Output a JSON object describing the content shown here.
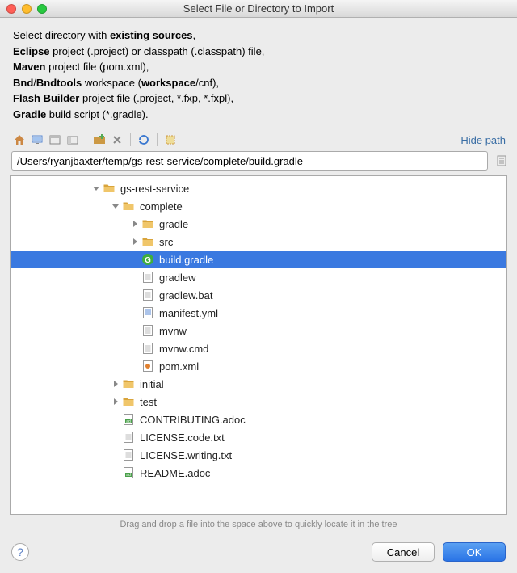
{
  "window": {
    "title": "Select File or Directory to Import"
  },
  "instructions": {
    "line1": {
      "prefix": "Select directory with ",
      "bold": "existing sources",
      "suffix": ","
    },
    "line2": {
      "bold": "Eclipse",
      "rest": " project (.project) or classpath (.classpath) file,"
    },
    "line3": {
      "bold": "Maven",
      "rest": " project file (pom.xml),"
    },
    "line4": {
      "b1": "Bnd",
      "sep": "/",
      "b2": "Bndtools",
      "mid": " workspace (",
      "b3": "workspace",
      "rest": "/cnf),"
    },
    "line5": {
      "bold": "Flash Builder",
      "rest": " project file (.project, *.fxp, *.fxpl),"
    },
    "line6": {
      "bold": "Gradle",
      "rest": " build script (*.gradle)."
    }
  },
  "toolbar": {
    "hide_path_label": "Hide path"
  },
  "path": {
    "value": "/Users/ryanjbaxter/temp/gs-rest-service/complete/build.gradle"
  },
  "tree": [
    {
      "depth": 0,
      "expand": "down",
      "icon": "folder",
      "label": "gs-rest-service",
      "selected": false
    },
    {
      "depth": 1,
      "expand": "down",
      "icon": "folder",
      "label": "complete",
      "selected": false
    },
    {
      "depth": 2,
      "expand": "right",
      "icon": "folder",
      "label": "gradle",
      "selected": false
    },
    {
      "depth": 2,
      "expand": "right",
      "icon": "folder",
      "label": "src",
      "selected": false
    },
    {
      "depth": 2,
      "expand": "none",
      "icon": "gradle",
      "label": "build.gradle",
      "selected": true
    },
    {
      "depth": 2,
      "expand": "none",
      "icon": "file",
      "label": "gradlew",
      "selected": false
    },
    {
      "depth": 2,
      "expand": "none",
      "icon": "file",
      "label": "gradlew.bat",
      "selected": false
    },
    {
      "depth": 2,
      "expand": "none",
      "icon": "yml",
      "label": "manifest.yml",
      "selected": false
    },
    {
      "depth": 2,
      "expand": "none",
      "icon": "file",
      "label": "mvnw",
      "selected": false
    },
    {
      "depth": 2,
      "expand": "none",
      "icon": "file",
      "label": "mvnw.cmd",
      "selected": false
    },
    {
      "depth": 2,
      "expand": "none",
      "icon": "xml",
      "label": "pom.xml",
      "selected": false
    },
    {
      "depth": 1,
      "expand": "right",
      "icon": "folder",
      "label": "initial",
      "selected": false
    },
    {
      "depth": 1,
      "expand": "right",
      "icon": "folder",
      "label": "test",
      "selected": false
    },
    {
      "depth": 1,
      "expand": "none",
      "icon": "adoc",
      "label": "CONTRIBUTING.adoc",
      "selected": false
    },
    {
      "depth": 1,
      "expand": "none",
      "icon": "file",
      "label": "LICENSE.code.txt",
      "selected": false
    },
    {
      "depth": 1,
      "expand": "none",
      "icon": "file",
      "label": "LICENSE.writing.txt",
      "selected": false
    },
    {
      "depth": 1,
      "expand": "none",
      "icon": "adoc",
      "label": "README.adoc",
      "selected": false
    }
  ],
  "hint": "Drag and drop a file into the space above to quickly locate it in the tree",
  "buttons": {
    "cancel": "Cancel",
    "ok": "OK"
  }
}
